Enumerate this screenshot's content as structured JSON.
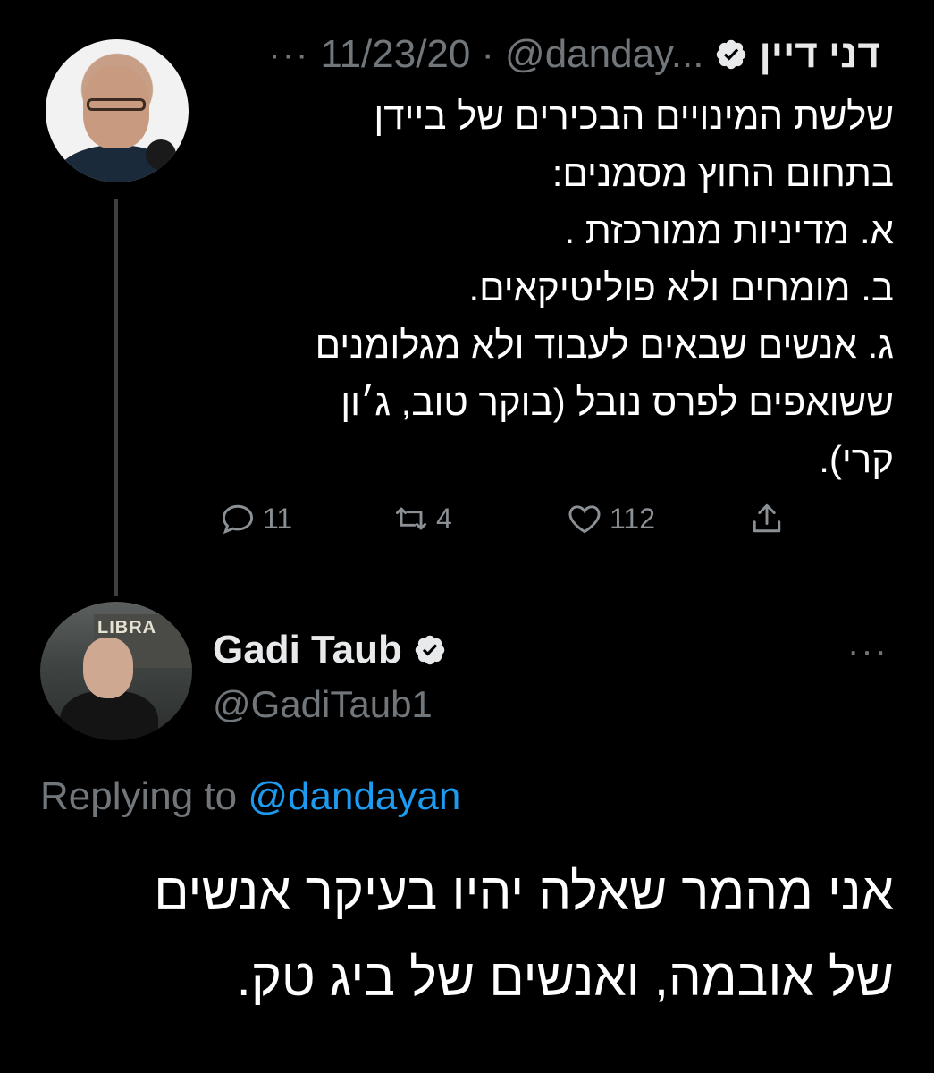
{
  "parent_tweet": {
    "author_name": "דני דיין",
    "handle": "@danday...",
    "separator": "·",
    "date": "11/23/20",
    "more_icon": "more-horizontal-icon",
    "verified": true,
    "text": "שלשת המינויים הבכירים של ביידן\nבתחום החוץ מסמנים:\nא. מדיניות ממורכזת .\nב. מומחים ולא פוליטיקאים.\nג. אנשים שבאים לעבוד ולא מגלומנים\nששואפים לפרס נובל (בוקר טוב, ג׳ון\nקרי).",
    "actions": {
      "replies": "11",
      "retweets": "4",
      "likes": "112"
    }
  },
  "reply_tweet": {
    "author_name": "Gadi Taub",
    "handle": "@GadiTaub1",
    "verified": true,
    "replying_prefix": "Replying to",
    "replying_to": "@dandayan",
    "text": "אני מהמר שאלה יהיו בעיקר אנשים\nשל אובמה, ואנשים של ביג טק."
  },
  "avatar_reply_sign": "LIBRA",
  "colors": {
    "background": "#000000",
    "primary_text": "#ffffff",
    "muted_text": "#71767b",
    "link": "#1d9bf0",
    "thread_line": "#3e4144"
  }
}
